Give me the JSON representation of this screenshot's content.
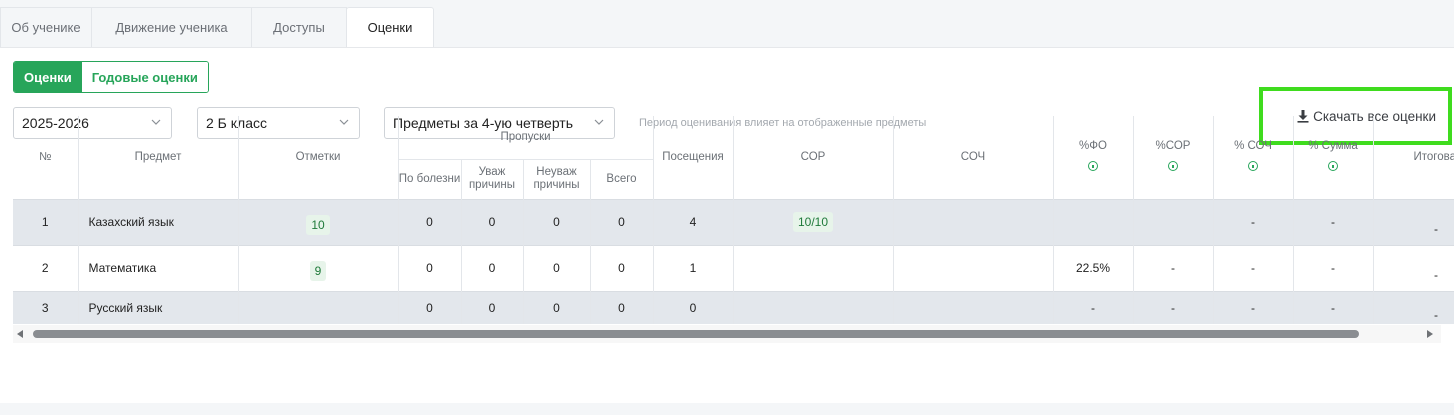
{
  "tabs": [
    {
      "label": "Об ученике",
      "active": false
    },
    {
      "label": "Движение ученика",
      "active": false
    },
    {
      "label": "Доступы",
      "active": false
    },
    {
      "label": "Оценки",
      "active": true
    }
  ],
  "segment": {
    "grades_label": "Оценки",
    "annual_label": "Годовые оценки"
  },
  "filters": {
    "year": "2025-2026",
    "class": "2 Б класс",
    "period": "Предметы за 4-ую четверть",
    "hint": "Период оценивания влияет на отображенные предметы"
  },
  "download_label": "Скачать все оценки",
  "colors": {
    "accent": "#27a55a",
    "highlight": "#3fdc1e"
  },
  "table": {
    "headers": {
      "num": "№",
      "subject": "Предмет",
      "marks": "Отметки",
      "absences": "Пропуски",
      "sick": "По болезни",
      "excused": "Уваж причины",
      "unexcused": "Неуваж причины",
      "total": "Всего",
      "attendance": "Посещения",
      "sor": "СОР",
      "soch": "СОЧ",
      "pct_fo": "%ФО",
      "pct_sor": "%СОР",
      "pct_soch": "% СОЧ",
      "pct_sum": "% Сумма",
      "final": "Итогова"
    },
    "rows": [
      {
        "num": "1",
        "subject": "Казахский язык",
        "marks": "10",
        "sick": "0",
        "excused": "0",
        "unexcused": "0",
        "total": "0",
        "attendance": "4",
        "sor": "10/10",
        "soch": "",
        "pct_fo": "",
        "pct_sor": "",
        "pct_soch": "-",
        "pct_sum": "-",
        "final": "-"
      },
      {
        "num": "2",
        "subject": "Математика",
        "marks": "9",
        "sick": "0",
        "excused": "0",
        "unexcused": "0",
        "total": "0",
        "attendance": "1",
        "sor": "",
        "soch": "",
        "pct_fo": "22.5%",
        "pct_sor": "-",
        "pct_soch": "-",
        "pct_sum": "-",
        "final": "-"
      },
      {
        "num": "3",
        "subject": "Русский язык",
        "marks": "",
        "sick": "0",
        "excused": "0",
        "unexcused": "0",
        "total": "0",
        "attendance": "0",
        "sor": "",
        "soch": "",
        "pct_fo": "-",
        "pct_sor": "-",
        "pct_soch": "-",
        "pct_sum": "-",
        "final": "-"
      }
    ]
  }
}
